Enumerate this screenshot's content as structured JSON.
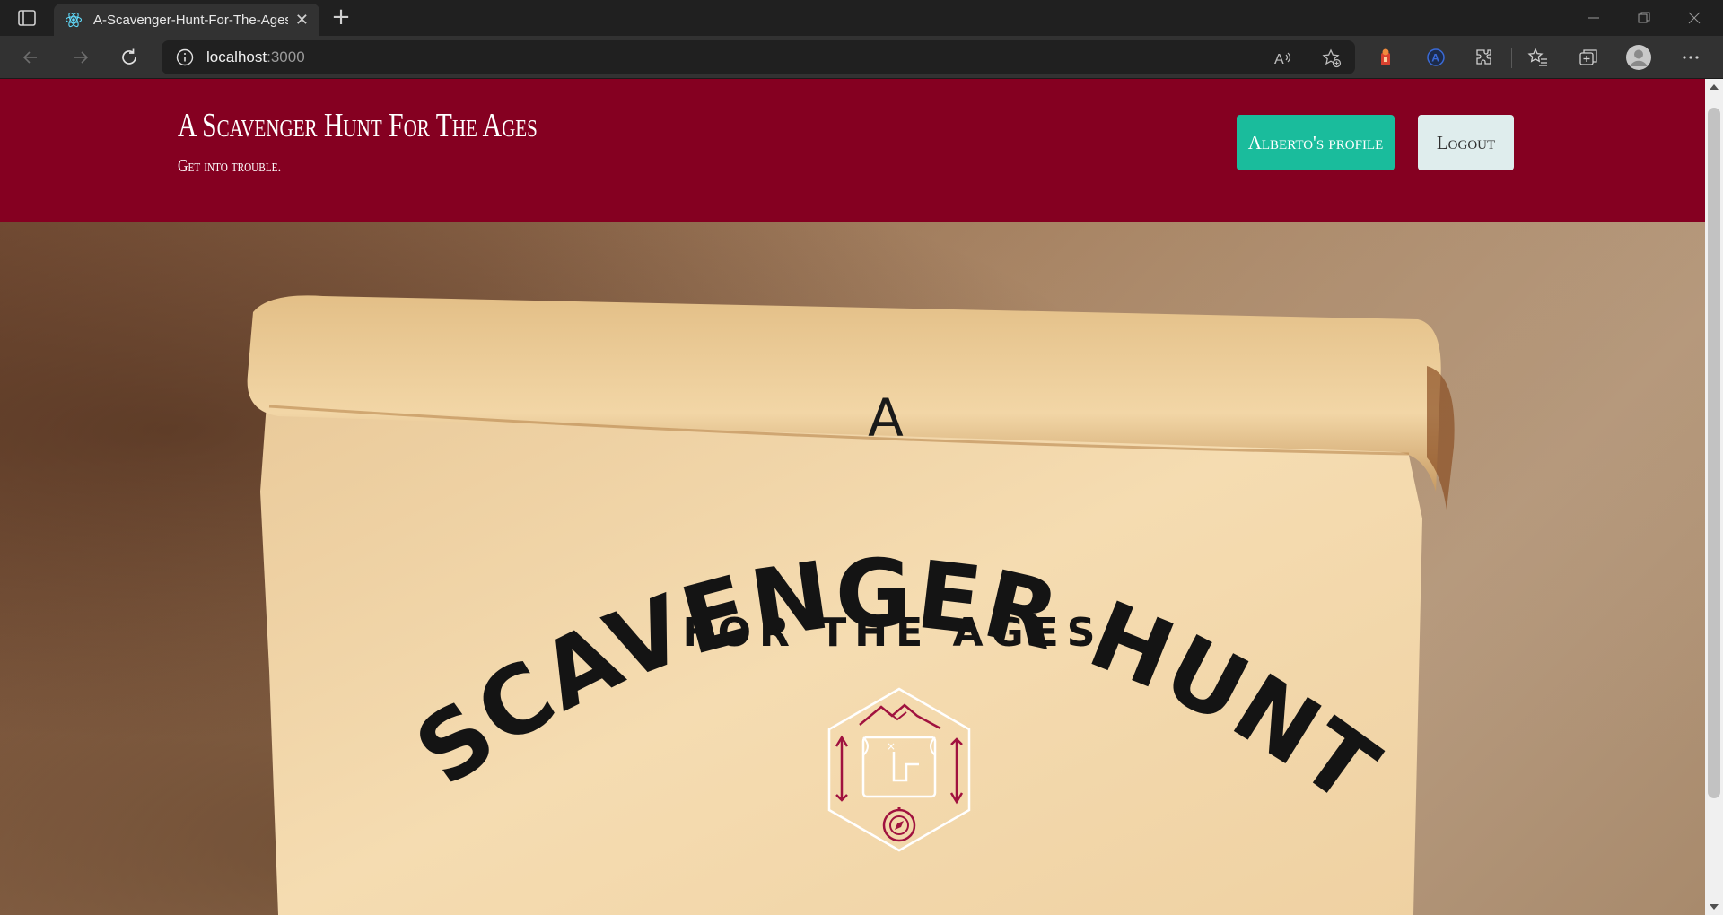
{
  "browser": {
    "tab": {
      "title": "A-Scavenger-Hunt-For-The-Ages",
      "favicon": "react-icon"
    },
    "address": {
      "host": "localhost",
      "port": ":3000"
    },
    "icons": {
      "back": "back-arrow-icon",
      "forward": "forward-arrow-icon",
      "refresh": "refresh-icon",
      "info": "info-icon",
      "read_aloud": "read-aloud-icon",
      "favorite_add": "add-favorite-icon",
      "extensions": "extensions-icon",
      "favorites": "favorites-icon",
      "collections": "collections-icon",
      "profile": "profile-avatar-icon",
      "menu": "more-menu-icon"
    }
  },
  "header": {
    "title": "A Scavenger Hunt For The Ages",
    "subtitle": "Get into trouble.",
    "profile_button": "Alberto's profile",
    "logout_button": "Logout",
    "colors": {
      "background": "#850021",
      "profile_button": "#1abc9c",
      "logout_button": "#dfeded"
    }
  },
  "hero": {
    "line_a": "A",
    "line_main": "SCAVENGER HUNT",
    "line_sub": "FOR THE AGES",
    "emblem": "treasure-map-compass-emblem",
    "accent_color": "#a0123f"
  }
}
